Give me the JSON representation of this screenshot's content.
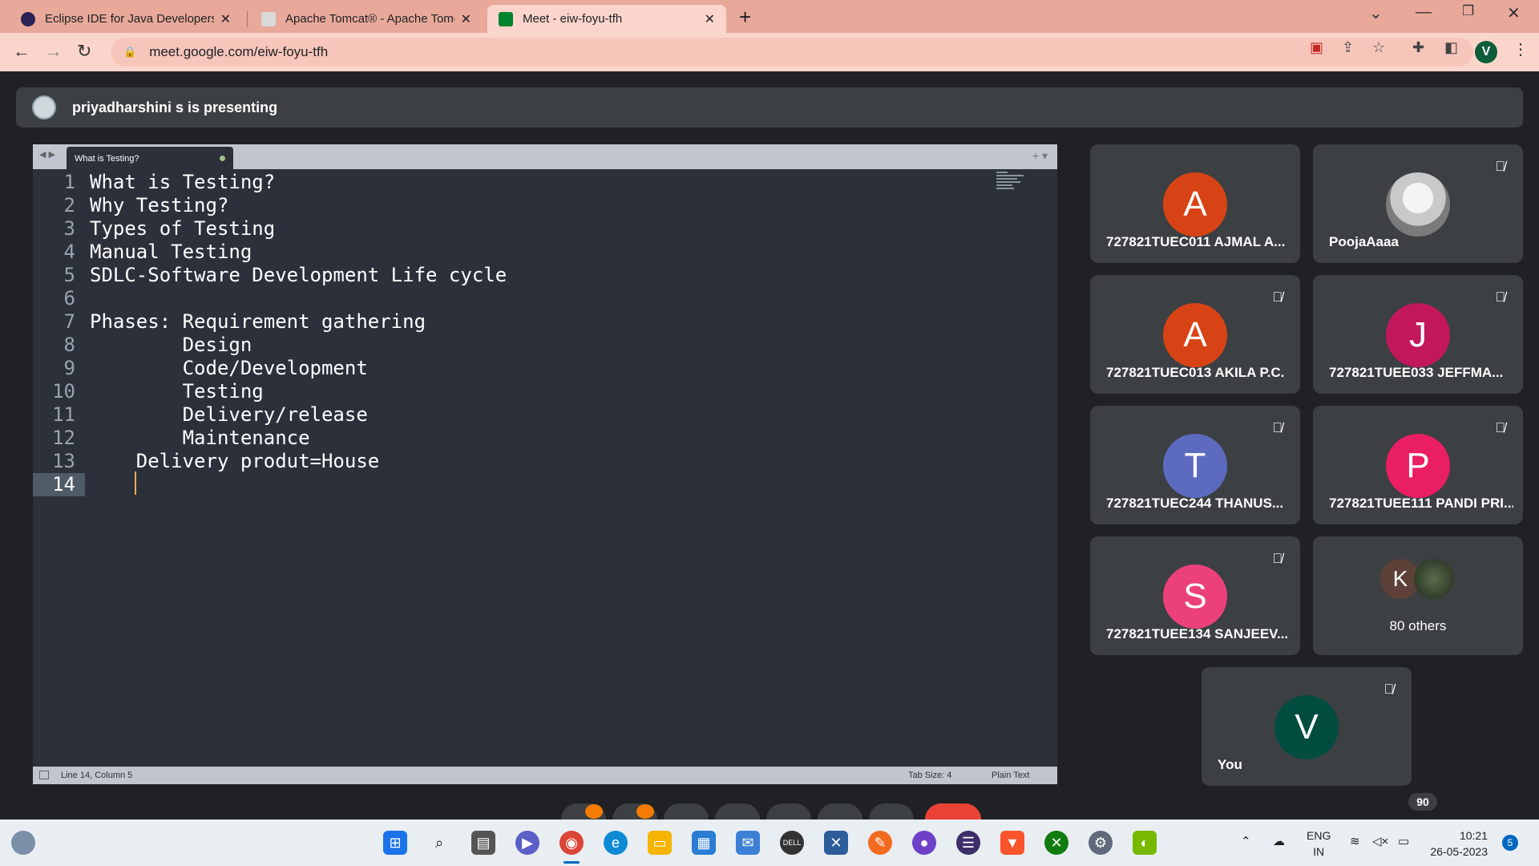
{
  "browser": {
    "tabs": [
      {
        "title": "Eclipse IDE for Java Developers | E",
        "favicon_color": "#2c2255"
      },
      {
        "title": "Apache Tomcat® - Apache Tomca",
        "favicon_color": "#d9d9d9"
      },
      {
        "title": "Meet - eiw-foyu-tfh",
        "favicon_color": "#00832d"
      }
    ],
    "url": "meet.google.com/eiw-foyu-tfh",
    "profile_initial": "V"
  },
  "meet": {
    "presenting_banner": "priyadharshini s is presenting",
    "participants": [
      {
        "name": "727821TUEC011 AJMAL A...",
        "initial": "A",
        "color": "#d84315",
        "muted": false
      },
      {
        "name": "PoojaAaaa",
        "initial": "",
        "color": "",
        "muted": true
      },
      {
        "name": "727821TUEC013 AKILA P.C.",
        "initial": "A",
        "color": "#d84315",
        "muted": true
      },
      {
        "name": "727821TUEE033 JEFFMA...",
        "initial": "J",
        "color": "#c2185b",
        "muted": true
      },
      {
        "name": "727821TUEC244 THANUS...",
        "initial": "T",
        "color": "#5c6bc0",
        "muted": true
      },
      {
        "name": "727821TUEE111 PANDI PRI...",
        "initial": "P",
        "color": "#e91e63",
        "muted": true
      },
      {
        "name": "727821TUEE134 SANJEEV...",
        "initial": "S",
        "color": "#ec407a",
        "muted": true
      }
    ],
    "others": {
      "initial": "K",
      "label": "80 others"
    },
    "self": {
      "name": "You",
      "initial": "V",
      "color": "#004d40",
      "muted": true
    },
    "participant_count": "90"
  },
  "editor": {
    "tab_title": "What is Testing?",
    "lines": [
      {
        "num": "1",
        "text": "What is Testing?"
      },
      {
        "num": "2",
        "text": "Why Testing?"
      },
      {
        "num": "3",
        "text": "Types of Testing"
      },
      {
        "num": "4",
        "text": "Manual Testing"
      },
      {
        "num": "5",
        "text": "SDLC-Software Development Life cycle"
      },
      {
        "num": "6",
        "text": ""
      },
      {
        "num": "7",
        "text": "Phases: Requirement gathering"
      },
      {
        "num": "8",
        "text": "        Design"
      },
      {
        "num": "9",
        "text": "        Code/Development"
      },
      {
        "num": "10",
        "text": "        Testing"
      },
      {
        "num": "11",
        "text": "        Delivery/release"
      },
      {
        "num": "12",
        "text": "        Maintenance"
      },
      {
        "num": "13",
        "text": "    Delivery produt=House"
      },
      {
        "num": "14",
        "text": ""
      }
    ],
    "status": {
      "position": "Line 14, Column 5",
      "tab_size": "Tab Size: 4",
      "syntax": "Plain Text"
    }
  },
  "taskbar": {
    "lang_line1": "ENG",
    "lang_line2": "IN",
    "time": "10:21",
    "date": "26-05-2023",
    "notification_count": "5"
  }
}
